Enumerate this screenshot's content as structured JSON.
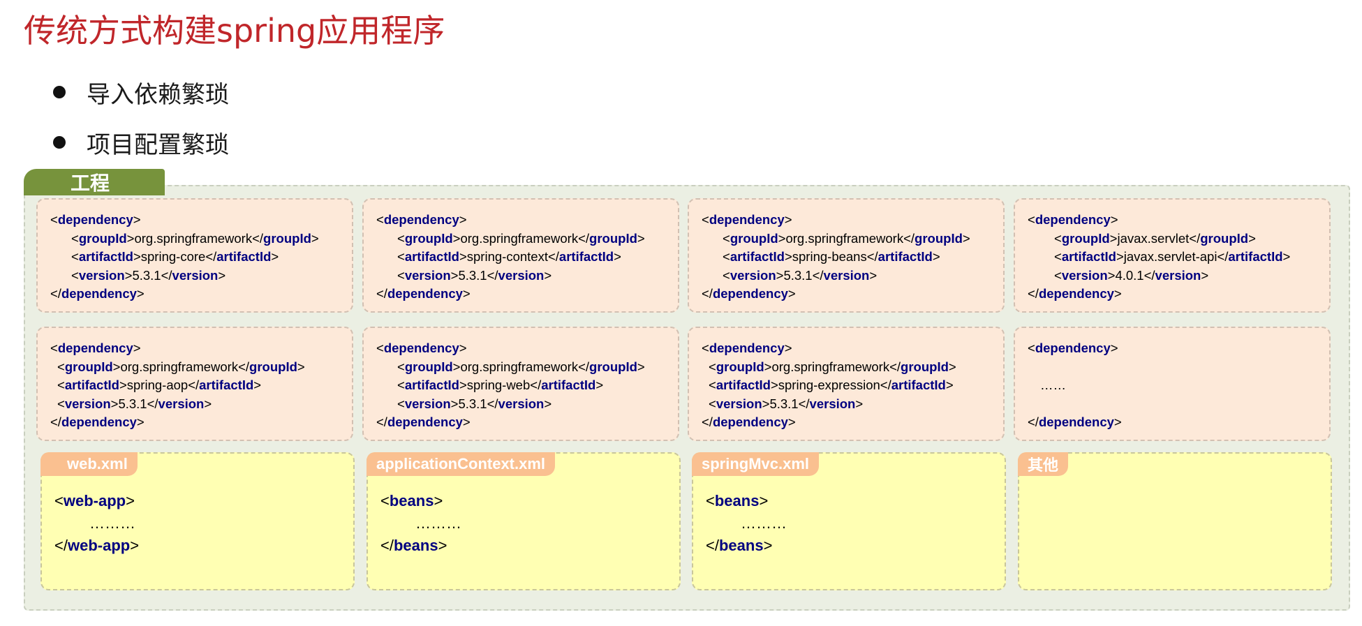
{
  "title": "传统方式构建spring应用程序",
  "bullets": [
    "导入依赖繁琐",
    "项目配置繁琐"
  ],
  "project_label": "工程",
  "dependencies": [
    {
      "groupId": "org.springframework",
      "artifactId": "spring-core",
      "version": "5.3.1"
    },
    {
      "groupId": "org.springframework",
      "artifactId": "spring-context",
      "version": "5.3.1"
    },
    {
      "groupId": "org.springframework",
      "artifactId": "spring-beans",
      "version": "5.3.1"
    },
    {
      "groupId": "javax.servlet",
      "artifactId": "javax.servlet-api",
      "version": "4.0.1"
    },
    {
      "groupId": "org.springframework",
      "artifactId": "spring-aop",
      "version": "5.3.1"
    },
    {
      "groupId": "org.springframework",
      "artifactId": "spring-web",
      "version": "5.3.1"
    },
    {
      "groupId": "org.springframework",
      "artifactId": "spring-expression",
      "version": "5.3.1"
    }
  ],
  "dependency_placeholder": "……",
  "tags": {
    "dependency": "dependency",
    "groupId": "groupId",
    "artifactId": "artifactId",
    "version": "version"
  },
  "configs": [
    {
      "label": "web.xml",
      "root": "web-app",
      "content": "………"
    },
    {
      "label": "applicationContext.xml",
      "root": "beans",
      "content": "………"
    },
    {
      "label": "springMvc.xml",
      "root": "beans",
      "content": "………"
    },
    {
      "label": "其他"
    }
  ]
}
